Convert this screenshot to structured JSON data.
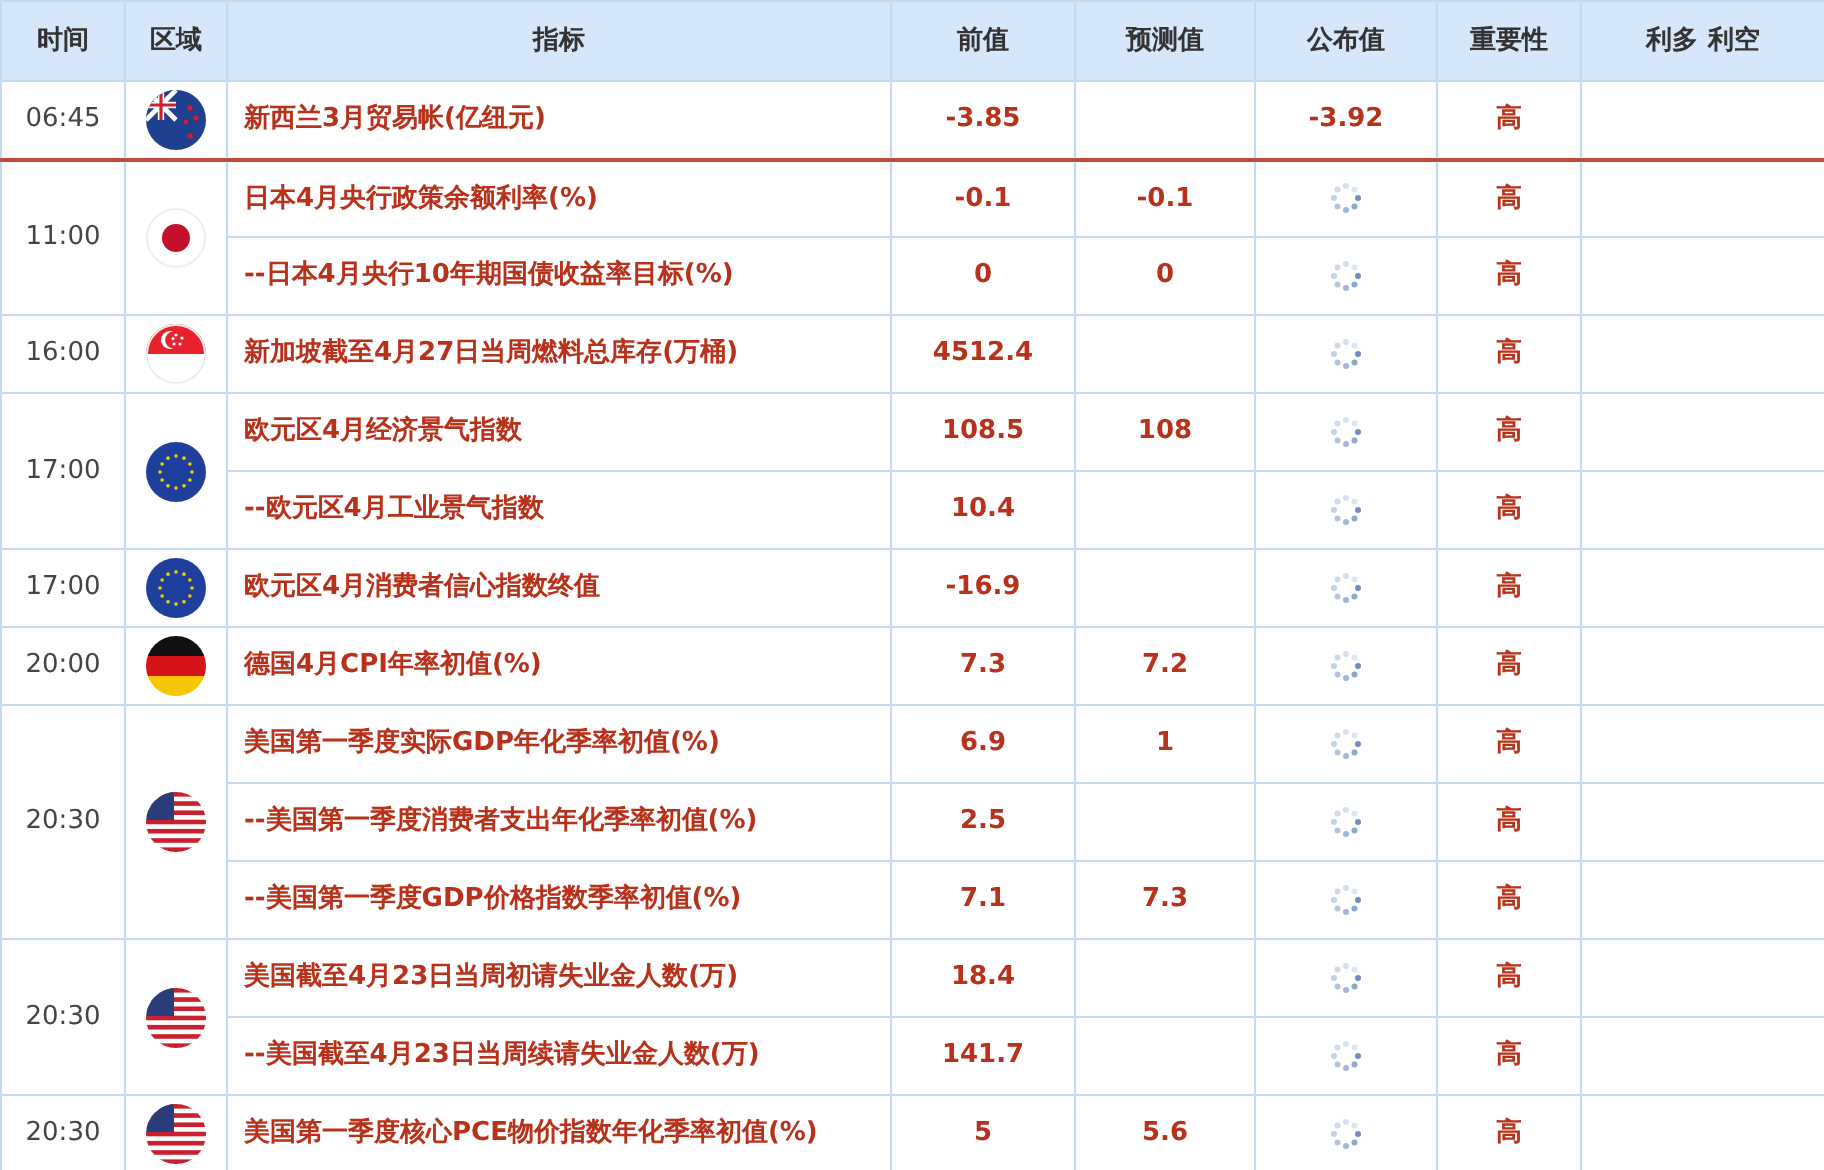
{
  "columns": [
    "时间",
    "区域",
    "指标",
    "前值",
    "预测值",
    "公布值",
    "重要性",
    "利多 利空"
  ],
  "groups": [
    {
      "time": "06:45",
      "kind": "nz",
      "divider_after": true,
      "rows": [
        {
          "indicator": "新西兰3月贸易帐(亿纽元)",
          "previous": "-3.85",
          "actual": "-3.92",
          "released": true,
          "importance": "高"
        }
      ]
    },
    {
      "time": "11:00",
      "kind": "jp",
      "divider_after": false,
      "rows": [
        {
          "indicator": "日本4月央行政策余额利率(%)",
          "previous": "-0.1",
          "forecast": "-0.1",
          "released": false,
          "importance": "高"
        },
        {
          "indicator": "--日本4月央行10年期国债收益率目标(%)",
          "previous": "0",
          "forecast": "0",
          "released": false,
          "importance": "高"
        }
      ]
    },
    {
      "time": "16:00",
      "kind": "sg",
      "divider_after": false,
      "rows": [
        {
          "indicator": "新加坡截至4月27日当周燃料总库存(万桶)",
          "previous": "4512.4",
          "released": false,
          "importance": "高"
        }
      ]
    },
    {
      "time": "17:00",
      "kind": "eu",
      "divider_after": false,
      "rows": [
        {
          "indicator": "欧元区4月经济景气指数",
          "previous": "108.5",
          "forecast": "108",
          "released": false,
          "importance": "高"
        },
        {
          "indicator": "--欧元区4月工业景气指数",
          "previous": "10.4",
          "released": false,
          "importance": "高"
        }
      ]
    },
    {
      "time": "17:00",
      "kind": "eu",
      "divider_after": false,
      "rows": [
        {
          "indicator": "欧元区4月消费者信心指数终值",
          "previous": "-16.9",
          "released": false,
          "importance": "高"
        }
      ]
    },
    {
      "time": "20:00",
      "kind": "de",
      "divider_after": false,
      "rows": [
        {
          "indicator": "德国4月CPI年率初值(%)",
          "previous": "7.3",
          "forecast": "7.2",
          "released": false,
          "importance": "高"
        }
      ]
    },
    {
      "time": "20:30",
      "kind": "us",
      "divider_after": false,
      "rows": [
        {
          "indicator": "美国第一季度实际GDP年化季率初值(%)",
          "previous": "6.9",
          "forecast": "1",
          "released": false,
          "importance": "高"
        },
        {
          "indicator": "--美国第一季度消费者支出年化季率初值(%)",
          "previous": "2.5",
          "released": false,
          "importance": "高"
        },
        {
          "indicator": "--美国第一季度GDP价格指数季率初值(%)",
          "previous": "7.1",
          "forecast": "7.3",
          "released": false,
          "importance": "高"
        }
      ]
    },
    {
      "time": "20:30",
      "kind": "us",
      "divider_after": false,
      "rows": [
        {
          "indicator": "美国截至4月23日当周初请失业金人数(万)",
          "previous": "18.4",
          "released": false,
          "importance": "高"
        },
        {
          "indicator": "--美国截至4月23日当周续请失业金人数(万)",
          "previous": "141.7",
          "released": false,
          "importance": "高"
        }
      ]
    },
    {
      "time": "20:30",
      "kind": "us",
      "divider_after": false,
      "rows": [
        {
          "indicator": "美国第一季度核心PCE物价指数年化季率初值(%)",
          "previous": "5",
          "forecast": "5.6",
          "released": false,
          "importance": "高"
        }
      ]
    }
  ]
}
